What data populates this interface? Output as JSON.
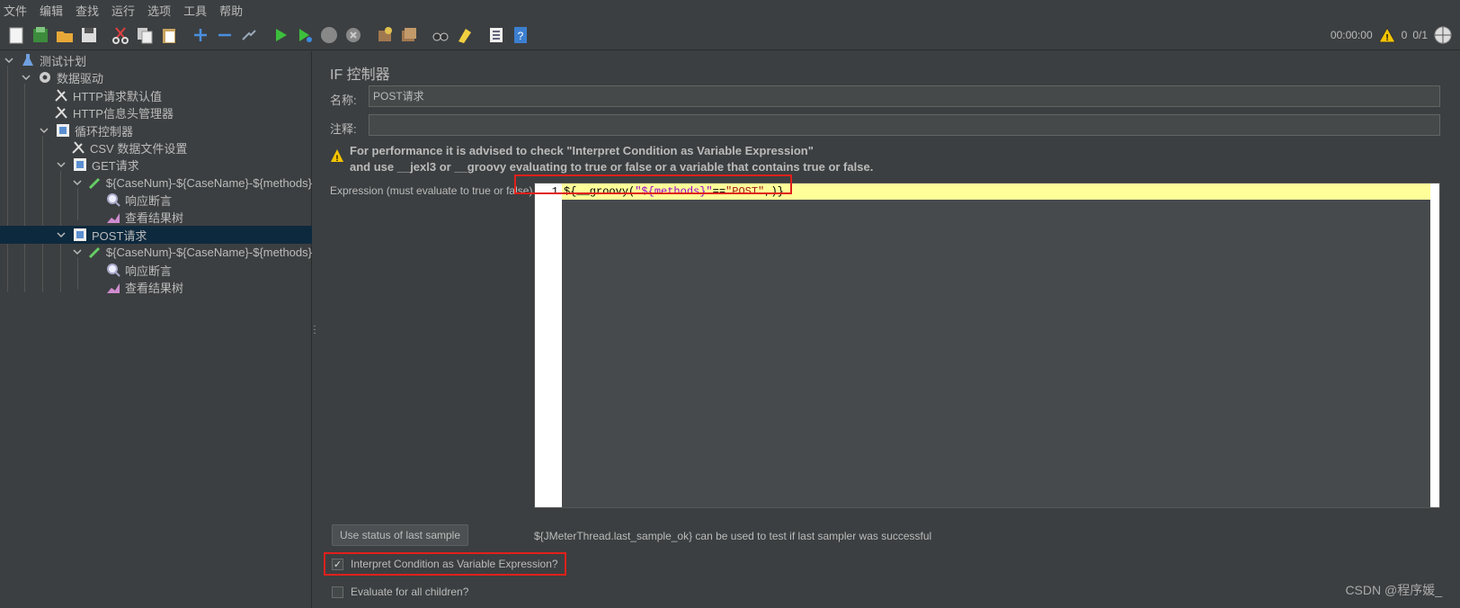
{
  "menu": [
    "文件",
    "编辑",
    "查找",
    "运行",
    "选项",
    "工具",
    "帮助"
  ],
  "status": {
    "timer": "00:00:00",
    "warnings": "0",
    "threads": "0/1"
  },
  "tree": [
    {
      "label": "测试计划",
      "icon": "flask-icon",
      "expanded": true
    },
    {
      "label": "数据驱动",
      "icon": "gear-icon",
      "expanded": true
    },
    {
      "label": "HTTP请求默认值",
      "icon": "wrench-icon"
    },
    {
      "label": "HTTP信息头管理器",
      "icon": "wrench-icon"
    },
    {
      "label": "循环控制器",
      "icon": "controller-icon",
      "expanded": true
    },
    {
      "label": "CSV 数据文件设置",
      "icon": "wrench-icon"
    },
    {
      "label": "GET请求",
      "icon": "controller-icon",
      "expanded": true
    },
    {
      "label": "${CaseNum}-${CaseName}-${methods}",
      "icon": "pipette-icon",
      "expanded": true
    },
    {
      "label": "响应断言",
      "icon": "magnifier-icon"
    },
    {
      "label": "查看结果树",
      "icon": "chart-icon"
    },
    {
      "label": "POST请求",
      "icon": "controller-icon",
      "expanded": true,
      "selected": true
    },
    {
      "label": "${CaseNum}-${CaseName}-${methods}",
      "icon": "pipette-icon",
      "expanded": true
    },
    {
      "label": "响应断言",
      "icon": "magnifier-icon"
    },
    {
      "label": "查看结果树",
      "icon": "chart-icon"
    }
  ],
  "panel": {
    "title": "IF 控制器",
    "name_label": "名称:",
    "name_value": "POST请求",
    "comment_label": "注释:",
    "comment_value": "",
    "warning_line1": "For performance it is advised to check \"Interpret Condition as Variable Expression\"",
    "warning_line2": "and use __jexl3 or __groovy evaluating to true or false or a variable that contains true or false.",
    "expression_label": "Expression (must evaluate to true or false)",
    "line_number": "1",
    "code": {
      "p1": "${",
      "p2": "__groovy(",
      "p3": "\"${methods}\"",
      "p4": "==",
      "p5": "\"POST\"",
      "p6": ",)}"
    },
    "use_status_button": "Use status of last sample",
    "hint": "${JMeterThread.last_sample_ok} can be used to test if last sampler was successful",
    "interpret_label": "Interpret Condition as Variable Expression?",
    "interpret_checked": true,
    "evaluate_label": "Evaluate for all children?",
    "evaluate_checked": false
  },
  "watermark": "CSDN @程序媛_"
}
